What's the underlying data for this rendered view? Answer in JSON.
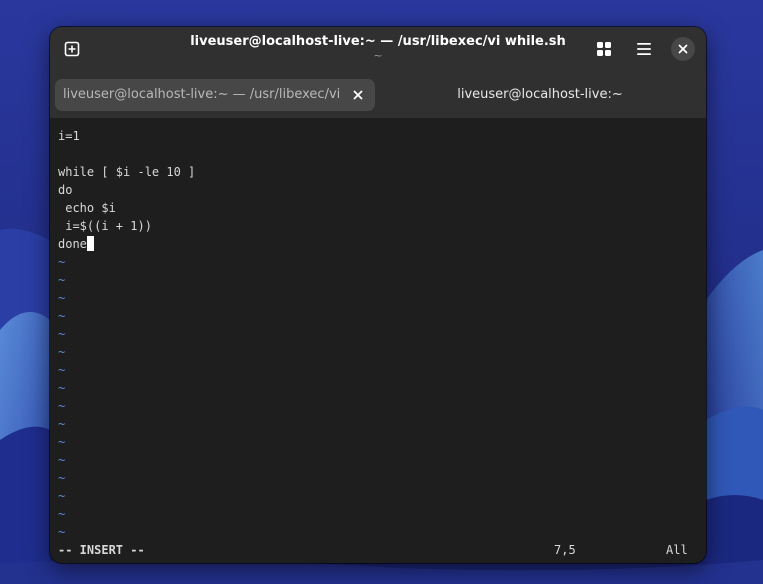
{
  "desktop": {
    "colors": {
      "bg_top": "#26349a",
      "bg_bottom": "#1b2578",
      "dune_light": "#4e7fd0",
      "dune_dark": "#1c2a88"
    }
  },
  "window": {
    "title": "liveuser@localhost-live:~ — /usr/libexec/vi while.sh",
    "subtitle": "~",
    "new_tab_icon": "new-tab-icon",
    "grid_icon": "grid-icon",
    "menu_icon": "hamburger-menu-icon",
    "close_icon": "close-icon",
    "colors": {
      "headerbar": "#303030",
      "active_tab": "#474747",
      "terminal_bg": "#1e1e1e",
      "text": "#d8d8d8",
      "tilde": "#5b8dd6"
    }
  },
  "tabs": [
    {
      "label": "liveuser@localhost-live:~ — /usr/libexec/vi while.sh",
      "active": true
    },
    {
      "label": "liveuser@localhost-live:~",
      "active": false
    }
  ],
  "editor": {
    "lines": [
      "i=1",
      "",
      "while [ $i -le 10 ]",
      "do",
      " echo $i",
      " i=$((i + 1))",
      "done"
    ],
    "tilde": "~",
    "tilde_count": 16,
    "status": {
      "mode": "-- INSERT --",
      "position": "7,5",
      "scroll": "All"
    }
  }
}
